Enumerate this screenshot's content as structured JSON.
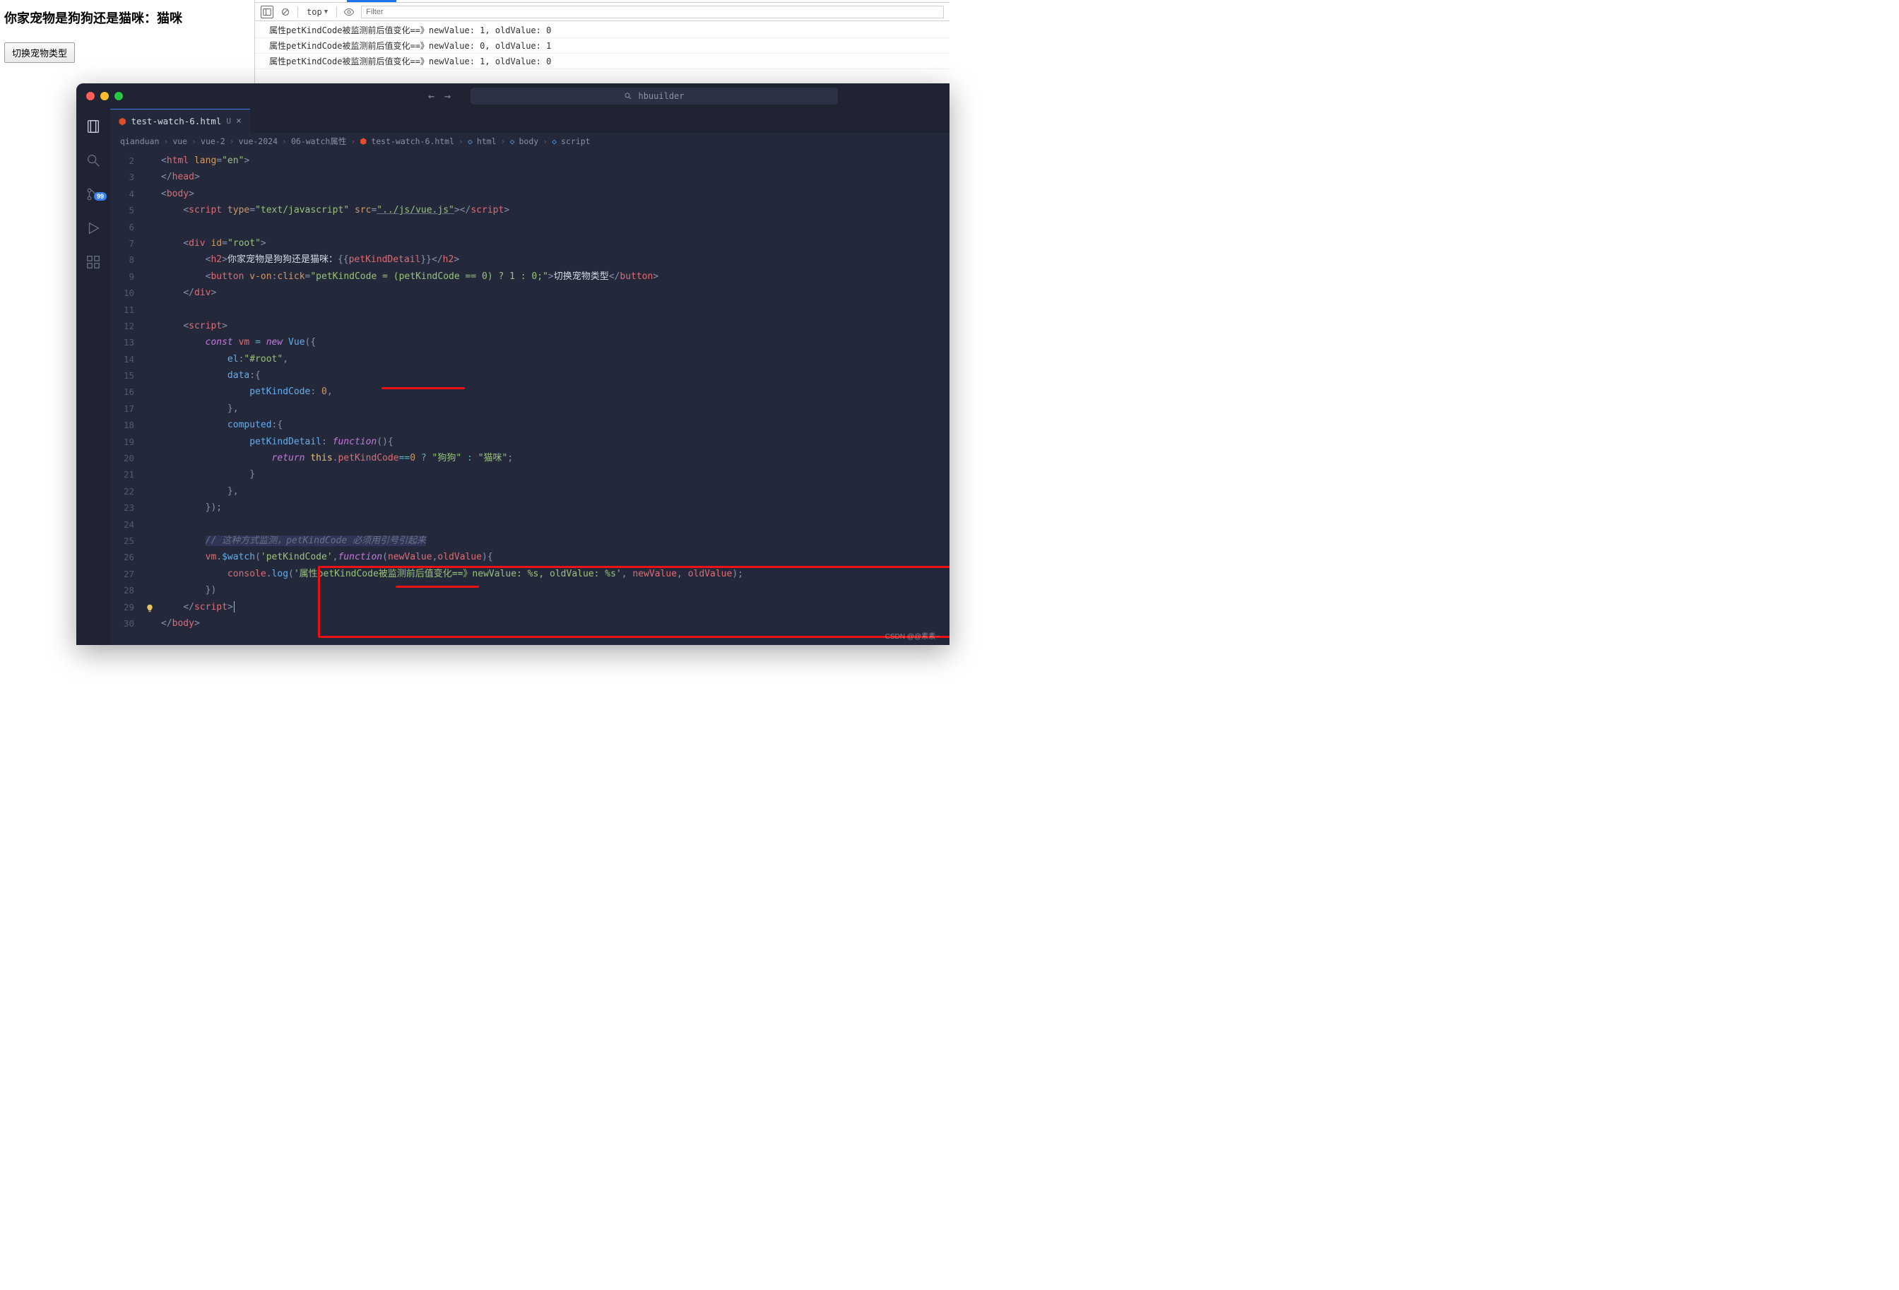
{
  "page": {
    "heading": "你家宠物是狗狗还是猫咪：猫咪",
    "button": "切换宠物类型"
  },
  "devtools": {
    "scope": "top",
    "filter_placeholder": "Filter",
    "logs": [
      "属性petKindCode被监测前后值变化==》newValue: 1, oldValue: 0",
      "属性petKindCode被监测前后值变化==》newValue: 0, oldValue: 1",
      "属性petKindCode被监测前后值变化==》newValue: 1, oldValue: 0"
    ]
  },
  "editor": {
    "search_placeholder": "hbuuilder",
    "badge": "99",
    "tab": {
      "filename": "test-watch-6.html",
      "modified": "U"
    },
    "breadcrumbs": [
      "qianduan",
      "vue",
      "vue-2",
      "vue-2024",
      "06-watch属性",
      "test-watch-6.html",
      "html",
      "body",
      "script"
    ],
    "line_start": 2,
    "code_tokens": [
      [
        [
          "p",
          "<"
        ],
        [
          "tg",
          "html"
        ],
        [
          "wt",
          " "
        ],
        [
          "at",
          "lang"
        ],
        [
          "p",
          "="
        ],
        [
          "st",
          "\"en\""
        ],
        [
          "p",
          ">"
        ]
      ],
      [
        [
          "p",
          "</"
        ],
        [
          "tg",
          "head"
        ],
        [
          "p",
          ">"
        ]
      ],
      [
        [
          "p",
          "<"
        ],
        [
          "tg",
          "body"
        ],
        [
          "p",
          ">"
        ]
      ],
      [
        [
          "wt",
          "    "
        ],
        [
          "p",
          "<"
        ],
        [
          "tg",
          "script"
        ],
        [
          "wt",
          " "
        ],
        [
          "at",
          "type"
        ],
        [
          "p",
          "="
        ],
        [
          "st",
          "\"text/javascript\""
        ],
        [
          "wt",
          " "
        ],
        [
          "at",
          "src"
        ],
        [
          "p",
          "="
        ],
        [
          "st ul",
          "\"../js/vue.js\""
        ],
        [
          "p",
          "></"
        ],
        [
          "tg",
          "script"
        ],
        [
          "p",
          ">"
        ]
      ],
      [],
      [
        [
          "wt",
          "    "
        ],
        [
          "p",
          "<"
        ],
        [
          "tg",
          "div"
        ],
        [
          "wt",
          " "
        ],
        [
          "at",
          "id"
        ],
        [
          "p",
          "="
        ],
        [
          "st",
          "\"root\""
        ],
        [
          "p",
          ">"
        ]
      ],
      [
        [
          "wt",
          "        "
        ],
        [
          "p",
          "<"
        ],
        [
          "tg",
          "h2"
        ],
        [
          "p",
          ">"
        ],
        [
          "wt",
          "你家宠物是狗狗还是猫咪："
        ],
        [
          "p",
          "{{"
        ],
        [
          "vr",
          "petKindDetail"
        ],
        [
          "p",
          "}}"
        ],
        [
          "p",
          "</"
        ],
        [
          "tg",
          "h2"
        ],
        [
          "p",
          ">"
        ]
      ],
      [
        [
          "wt",
          "        "
        ],
        [
          "p",
          "<"
        ],
        [
          "tg",
          "button"
        ],
        [
          "wt",
          " "
        ],
        [
          "at",
          "v-on"
        ],
        [
          "p",
          ":"
        ],
        [
          "at",
          "click"
        ],
        [
          "p",
          "="
        ],
        [
          "st",
          "\"petKindCode = (petKindCode == 0) ? 1 : 0;\""
        ],
        [
          "p",
          ">"
        ],
        [
          "wt",
          "切换宠物类型"
        ],
        [
          "p",
          "</"
        ],
        [
          "tg",
          "button"
        ],
        [
          "p",
          ">"
        ]
      ],
      [
        [
          "wt",
          "    "
        ],
        [
          "p",
          "</"
        ],
        [
          "tg",
          "div"
        ],
        [
          "p",
          ">"
        ]
      ],
      [],
      [
        [
          "wt",
          "    "
        ],
        [
          "p",
          "<"
        ],
        [
          "tg",
          "script"
        ],
        [
          "p",
          ">"
        ]
      ],
      [
        [
          "wt",
          "        "
        ],
        [
          "kw",
          "const"
        ],
        [
          "wt",
          " "
        ],
        [
          "vr",
          "vm"
        ],
        [
          "wt",
          " "
        ],
        [
          "op",
          "="
        ],
        [
          "wt",
          " "
        ],
        [
          "kw",
          "new"
        ],
        [
          "wt",
          " "
        ],
        [
          "fn",
          "Vue"
        ],
        [
          "p",
          "({"
        ]
      ],
      [
        [
          "wt",
          "            "
        ],
        [
          "fn",
          "el"
        ],
        [
          "p",
          ":"
        ],
        [
          "st",
          "\"#root\""
        ],
        [
          "p",
          ","
        ]
      ],
      [
        [
          "wt",
          "            "
        ],
        [
          "fn",
          "data"
        ],
        [
          "p",
          ":{"
        ]
      ],
      [
        [
          "wt",
          "                "
        ],
        [
          "fn",
          "petKindCode"
        ],
        [
          "p",
          ": "
        ],
        [
          "nm",
          "0"
        ],
        [
          "p",
          ","
        ]
      ],
      [
        [
          "wt",
          "            "
        ],
        [
          "p",
          "},"
        ]
      ],
      [
        [
          "wt",
          "            "
        ],
        [
          "fn",
          "computed"
        ],
        [
          "p",
          ":{"
        ]
      ],
      [
        [
          "wt",
          "                "
        ],
        [
          "fn",
          "petKindDetail"
        ],
        [
          "p",
          ": "
        ],
        [
          "kw",
          "function"
        ],
        [
          "p",
          "(){"
        ]
      ],
      [
        [
          "wt",
          "                    "
        ],
        [
          "kw",
          "return"
        ],
        [
          "wt",
          " "
        ],
        [
          "th",
          "this"
        ],
        [
          "p",
          "."
        ],
        [
          "vr",
          "petKindCode"
        ],
        [
          "op",
          "=="
        ],
        [
          "nm",
          "0"
        ],
        [
          "wt",
          " "
        ],
        [
          "op",
          "?"
        ],
        [
          "wt",
          " "
        ],
        [
          "st",
          "\"狗狗\""
        ],
        [
          "wt",
          " "
        ],
        [
          "op",
          ":"
        ],
        [
          "wt",
          " "
        ],
        [
          "st",
          "\"猫咪\""
        ],
        [
          "p",
          ";"
        ]
      ],
      [
        [
          "wt",
          "                "
        ],
        [
          "p",
          "}"
        ]
      ],
      [
        [
          "wt",
          "            "
        ],
        [
          "p",
          "},"
        ]
      ],
      [
        [
          "wt",
          "        "
        ],
        [
          "p",
          "});"
        ]
      ],
      [],
      [
        [
          "wt",
          "        "
        ],
        [
          "cm sel",
          "// 这种方式监测，petKindCode 必须用引号引起来"
        ]
      ],
      [
        [
          "wt",
          "        "
        ],
        [
          "vr",
          "vm"
        ],
        [
          "p",
          "."
        ],
        [
          "fn",
          "$watch"
        ],
        [
          "p",
          "("
        ],
        [
          "st",
          "'petKindCode'"
        ],
        [
          "p",
          ","
        ],
        [
          "kw",
          "function"
        ],
        [
          "p",
          "("
        ],
        [
          "vr",
          "newValue"
        ],
        [
          "p",
          ","
        ],
        [
          "vr",
          "oldValue"
        ],
        [
          "p",
          "){"
        ]
      ],
      [
        [
          "wt",
          "            "
        ],
        [
          "vr",
          "console"
        ],
        [
          "p",
          "."
        ],
        [
          "fn",
          "log"
        ],
        [
          "p",
          "("
        ],
        [
          "st",
          "'属性petKindCode被监测前后值变化==》newValue: %s, oldValue: %s'"
        ],
        [
          "p",
          ", "
        ],
        [
          "vr",
          "newValue"
        ],
        [
          "p",
          ", "
        ],
        [
          "vr",
          "oldValue"
        ],
        [
          "p",
          ");"
        ]
      ],
      [
        [
          "wt",
          "        "
        ],
        [
          "p",
          "})"
        ]
      ],
      [
        [
          "wt",
          "    "
        ],
        [
          "p",
          "</"
        ],
        [
          "tg",
          "script"
        ],
        [
          "p",
          ">"
        ]
      ],
      [
        [
          "p",
          "</"
        ],
        [
          "tg",
          "body"
        ],
        [
          "p",
          ">"
        ]
      ]
    ]
  },
  "watermark": "CSDN @@素素~"
}
